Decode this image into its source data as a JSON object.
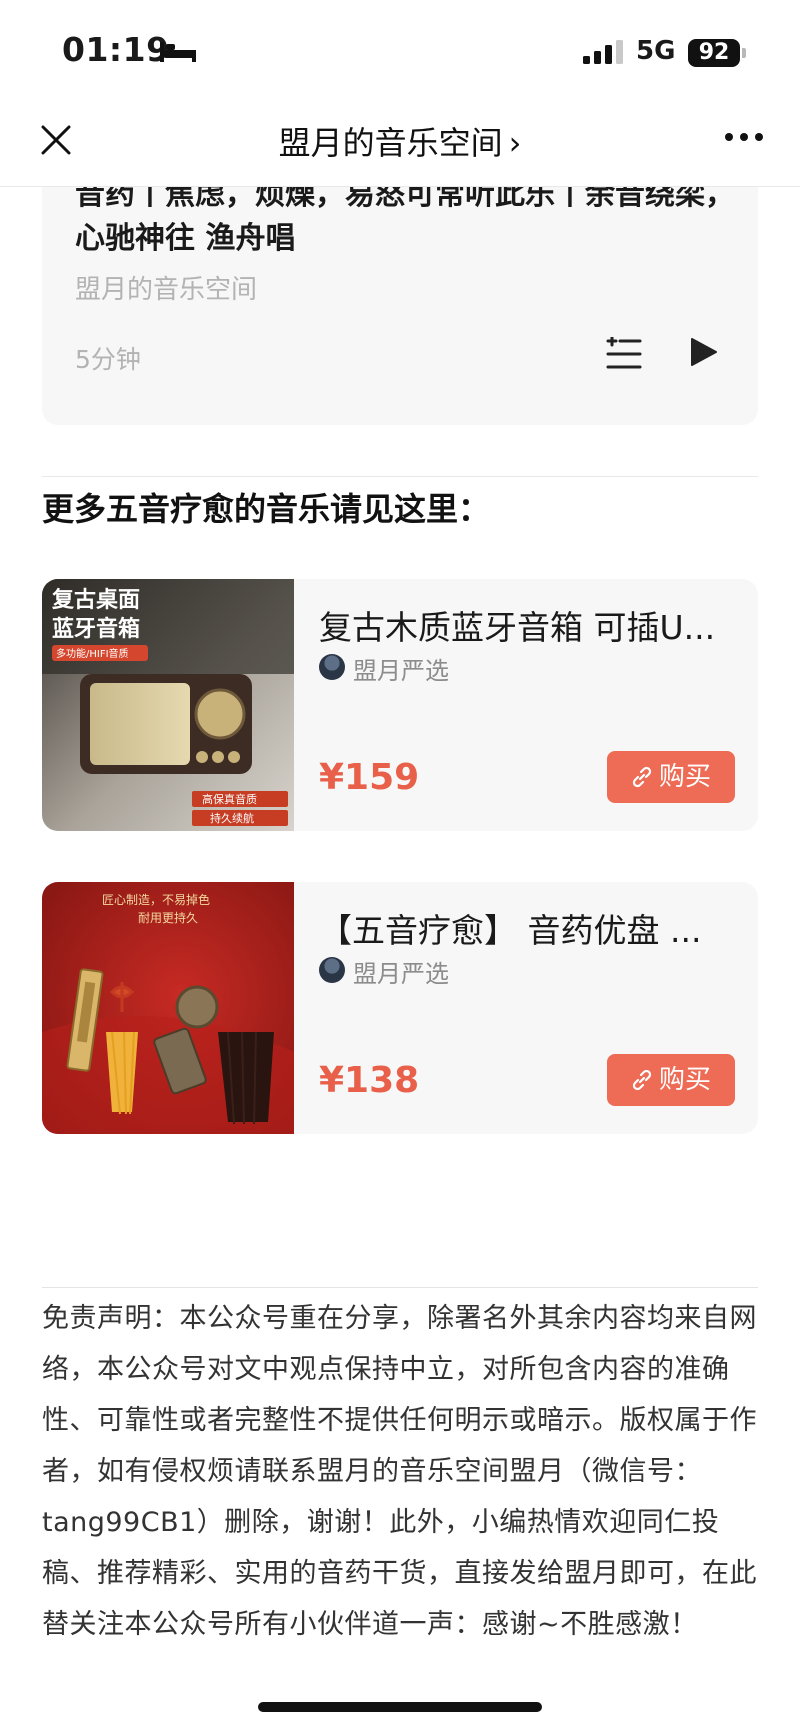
{
  "status_bar": {
    "time": "01:19",
    "network": "5G",
    "battery": "92"
  },
  "nav": {
    "title": "盟月的音乐空间",
    "chevron": "›"
  },
  "audio": {
    "title": "音药丨焦虑，烦燥，易怒可常听此乐丨余音绕梁，心驰神往 渔舟唱",
    "author": "盟月的音乐空间",
    "duration": "5分钟"
  },
  "section": {
    "heading": "更多五音疗愈的音乐请见这里："
  },
  "products": [
    {
      "title": "复古木质蓝牙音箱 可插U...",
      "shop": "盟月严选",
      "price": "¥159",
      "buy_label": "购买",
      "image": {
        "line1": "复古桌面",
        "line2": "蓝牙音箱",
        "tag": "多功能/HIFI音质",
        "badge1": "高保真音质",
        "badge2": "持久续航"
      }
    },
    {
      "title": "【五音疗愈】 音药优盘 ...",
      "shop": "盟月严选",
      "price": "¥138",
      "buy_label": "购买",
      "image": {
        "line1": "匠心制造，不易掉色",
        "line2": "耐用更持久"
      }
    }
  ],
  "disclaimer": "免责声明：本公众号重在分享，除署名外其余内容均来自网络，本公众号对文中观点保持中立，对所包含内容的准确性、可靠性或者完整性不提供任何明示或暗示。版权属于作者，如有侵权烦请联系盟月的音乐空间盟月（微信号：tang99CB1）删除，谢谢！此外，小编热情欢迎同仁投稿、推荐精彩、实用的音药干货，直接发给盟月即可，在此替关注本公众号所有小伙伴道一声：感谢~不胜感激！",
  "colors": {
    "accent": "#ee6b55",
    "price": "#e8604a",
    "card_bg": "#f7f7f7",
    "muted": "#b3b3b3"
  }
}
